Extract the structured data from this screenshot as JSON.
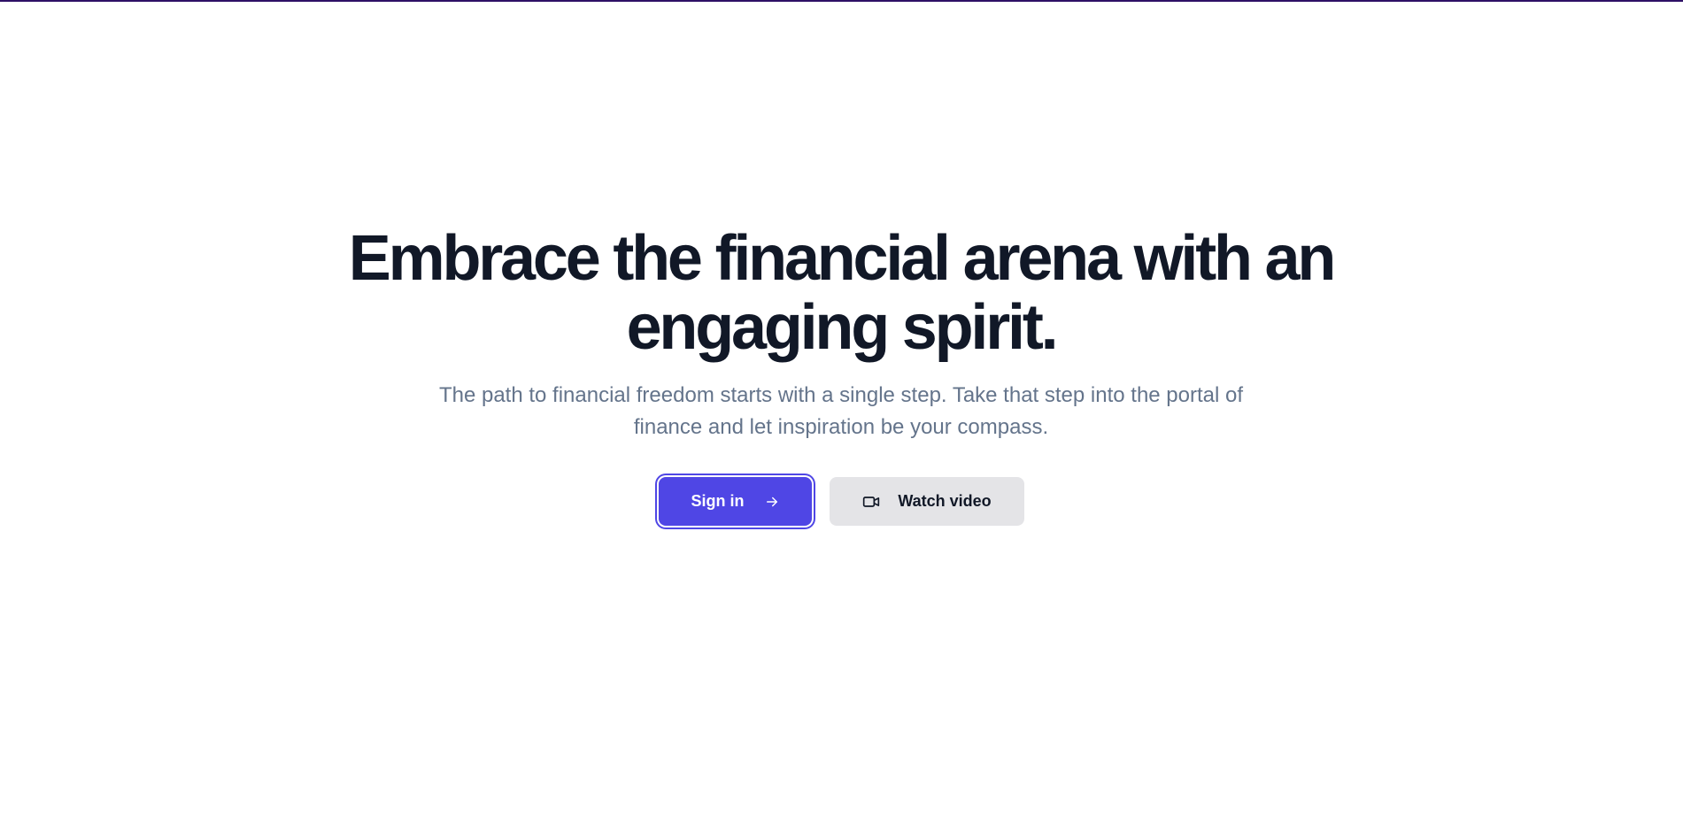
{
  "hero": {
    "headline_line1": "Embrace the financial arena with an",
    "headline_line2": "engaging spirit.",
    "subtext_line1": "The path to financial freedom starts with a single step. Take that step into the portal of",
    "subtext_line2": "finance and let inspiration be your compass."
  },
  "actions": {
    "sign_in": {
      "label": "Sign in",
      "icon": "arrow-right-icon"
    },
    "watch_video": {
      "label": "Watch video",
      "icon": "video-camera-icon"
    }
  },
  "colors": {
    "accent": "#4f46e5",
    "heading": "#111827",
    "muted_text": "#64748b",
    "secondary_button_bg": "#e4e4e7",
    "top_bar": "#2e1065"
  }
}
